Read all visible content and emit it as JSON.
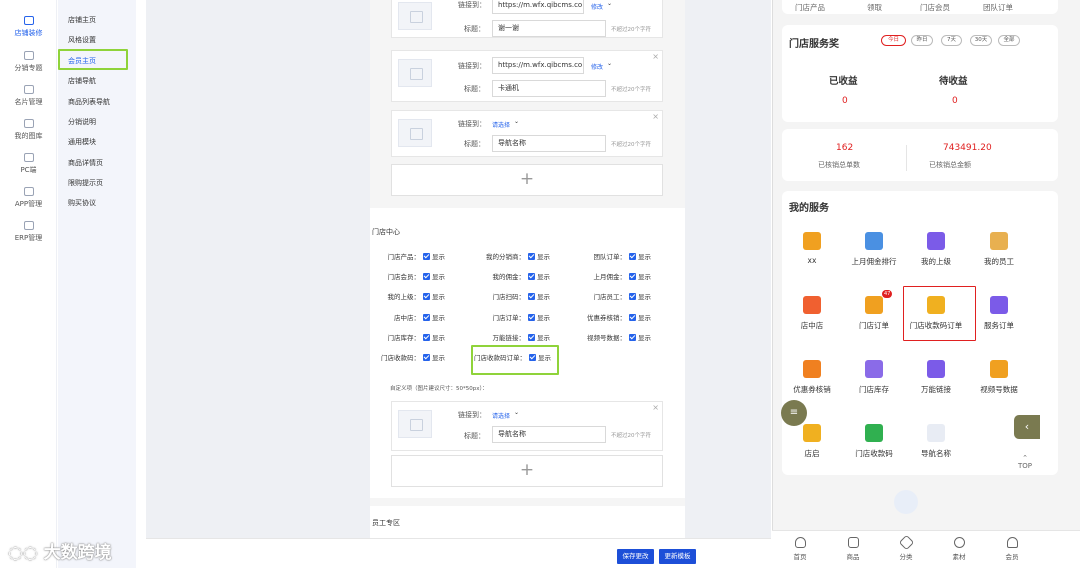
{
  "left_nav": [
    {
      "label": "店铺装修",
      "active": true
    },
    {
      "label": "分销专题"
    },
    {
      "label": "名片管理"
    },
    {
      "label": "我的图库"
    },
    {
      "label": "PC端"
    },
    {
      "label": "APP管理"
    },
    {
      "label": "ERP管理"
    }
  ],
  "sub_nav": [
    "店铺主页",
    "风格设置",
    "会员主页",
    "店铺导航",
    "商品列表导航",
    "分销说明",
    "通用模块",
    "商品详情页",
    "限购提示页",
    "购买协议"
  ],
  "editor": {
    "cards": [
      {
        "link_label": "链接到：",
        "url": "https://m.wfx.qibcms.co",
        "modify": "修改",
        "title_label": "标题：",
        "title": "谢一谢",
        "hint": "不超过20个字符"
      },
      {
        "link_label": "链接到：",
        "url": "https://m.wfx.qibcms.co",
        "modify": "修改",
        "title_label": "标题：",
        "title": "卡通机",
        "hint": "不超过20个字符"
      },
      {
        "link_label": "链接到：",
        "select": "请选择",
        "title_label": "标题：",
        "title": "导航名称",
        "hint": "不超过20个字符"
      }
    ],
    "add": "+",
    "store_center": "门店中心",
    "options": [
      [
        "门店产品：",
        "我的分销商：",
        "团队订单："
      ],
      [
        "门店会员：",
        "我的佣金：",
        "上月佣金："
      ],
      [
        "我的上级：",
        "门店扫码：",
        "门店员工："
      ],
      [
        "店中店：",
        "门店订单：",
        "优惠券核销："
      ],
      [
        "门店库存：",
        "万能链接：",
        "视频号数据："
      ],
      [
        "门店收款码：",
        "门店收款码订单：",
        ""
      ]
    ],
    "show": "显示",
    "custom_label": "自定义项（图片建议尺寸：50*50px）：",
    "card4": {
      "link_label": "链接到：",
      "select": "请选择",
      "title_label": "标题：",
      "title": "导航名称",
      "hint": "不超过20个字符"
    },
    "staff_area": "员工专区"
  },
  "buttons": {
    "save": "保存更改",
    "reset": "更新模板"
  },
  "watermark": "大数跨境",
  "phone": {
    "top_row": [
      "门店产品",
      "领取",
      "门店会员",
      "团队订单"
    ],
    "award_title": "门店服务奖",
    "filters": [
      "今日",
      "昨日",
      "7天",
      "30天",
      "全部"
    ],
    "earned_label": "已收益",
    "earned_value": "0",
    "pending_label": "待收益",
    "pending_value": "0",
    "orders_count": "162",
    "orders_label": "已核销总单数",
    "amount": "743491.20",
    "amount_label": "已核销总金额",
    "services_title": "我的服务",
    "services": [
      {
        "label": "xx",
        "color": "#f0a020"
      },
      {
        "label": "上月佣金排行",
        "color": "#4a90e2"
      },
      {
        "label": "我的上级",
        "color": "#7b5be8"
      },
      {
        "label": "我的员工",
        "color": "#e8b050"
      },
      {
        "label": "店中店",
        "color": "#f06030"
      },
      {
        "label": "门店订单",
        "color": "#f0a020",
        "badge": "47"
      },
      {
        "label": "门店收款码订单",
        "color": "#f0b020"
      },
      {
        "label": "服务订单",
        "color": "#7b5be8"
      },
      {
        "label": "优惠券核销",
        "color": "#f08020"
      },
      {
        "label": "门店库存",
        "color": "#8a6be8"
      },
      {
        "label": "万能链接",
        "color": "#7b5be8"
      },
      {
        "label": "视频号数据",
        "color": "#f0a020"
      },
      {
        "label": "店启",
        "color": "#f0b020"
      },
      {
        "label": "门店收款码",
        "color": "#30b050"
      },
      {
        "label": "导航名称",
        "color": "#e8ecf4"
      }
    ],
    "top_label": "TOP",
    "tabs": [
      "首页",
      "商品",
      "分类",
      "素材",
      "会员"
    ]
  }
}
